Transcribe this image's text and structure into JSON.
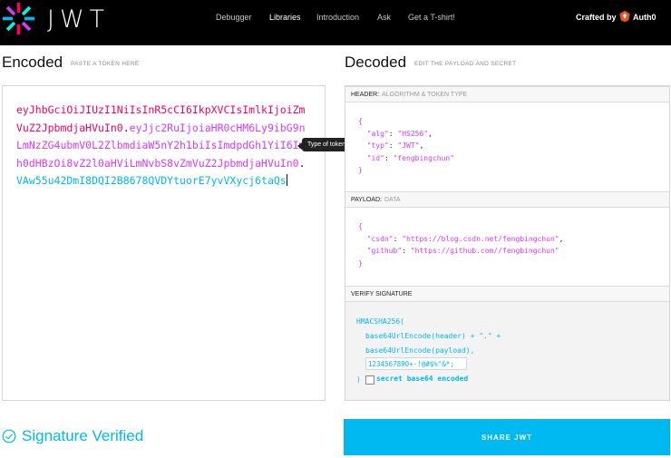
{
  "nav": {
    "wordmark": "JWT",
    "links": [
      "Debugger",
      "Libraries",
      "Introduction",
      "Ask",
      "Get a T-shirt!"
    ],
    "active_link": "Libraries",
    "crafted_by": "Crafted by",
    "brand": "Auth0",
    "icons": [
      "jwt-logo-icon",
      "auth0-shield-icon"
    ]
  },
  "encoded": {
    "title": "Encoded",
    "subtitle": "PASTE A TOKEN HERE",
    "token_header": "eyJhbGciOiJIUzI1NiIsInR5cCI6IkpXVCIsImlkIjoiZmVuZ2JpbmdjaHVuIn0",
    "token_payload": "eyJjc2RuIjoiaHR0cHM6Ly9ibG9nLmNzZG4ubmV0L2ZlbmdiaW5nY2h1biIsImdpdGh1YiI6Imh0dHBzOi8vZ2l0aHViLmNvbS8vZmVuZ2JpbmdjaHVuIn0",
    "token_signature": "VAw55u42DmI8DQI2B8678QVDYtuorE7yvVXycj6taQs",
    "separator": ".",
    "tooltip": "Type of token"
  },
  "decoded": {
    "title": "Decoded",
    "subtitle": "EDIT THE PAYLOAD AND SECRET",
    "header_label": "HEADER:",
    "header_sub": "ALGORITHM & TOKEN TYPE",
    "header_json": [
      [
        "alg",
        "HS256"
      ],
      [
        "typ",
        "JWT"
      ],
      [
        "id",
        "fengbingchun"
      ]
    ],
    "payload_label": "PAYLOAD:",
    "payload_sub": "DATA",
    "payload_json": [
      [
        "csdn",
        "https://blog.csdn.net/fengbingchun"
      ],
      [
        "github",
        "https://github.com//fengbingchun"
      ]
    ],
    "verify_label": "VERIFY SIGNATURE",
    "verify_fn": "HMACSHA256(",
    "verify_line1": "base64UrlEncode(header) + \".\" +",
    "verify_line2": "base64UrlEncode(payload),",
    "secret_value": "1234567890+-!@#$%^&*;",
    "close_paren": ")",
    "secret_b64_label": "secret base64 encoded",
    "secret_b64_checked": false
  },
  "footer": {
    "status": "Signature Verified",
    "share_button": "SHARE JWT"
  },
  "colors": {
    "header_red": "#fb015b",
    "payload_purple": "#d63aff",
    "signature_blue": "#00b9f1"
  }
}
